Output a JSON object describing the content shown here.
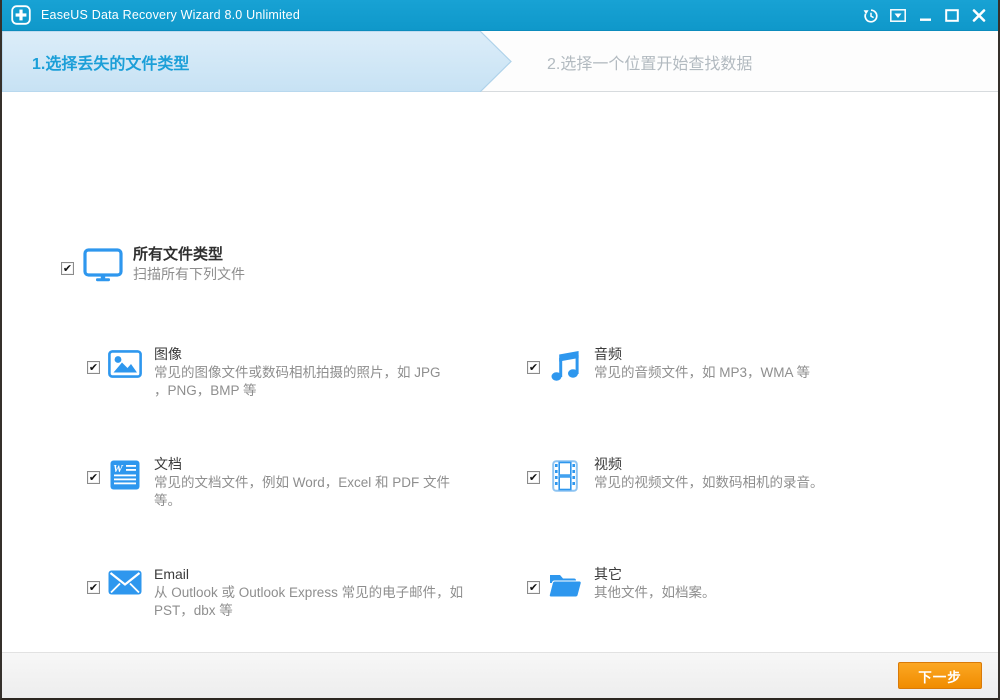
{
  "window": {
    "title": "EaseUS Data Recovery Wizard 8.0 Unlimited"
  },
  "titlebar_icons": [
    {
      "name": "history-icon"
    },
    {
      "name": "window-menu-icon"
    },
    {
      "name": "minimize-icon"
    },
    {
      "name": "maximize-icon"
    },
    {
      "name": "close-icon"
    }
  ],
  "steps": [
    {
      "label": "1.选择丢失的文件类型",
      "active": true
    },
    {
      "label": "2.选择一个位置开始查找数据",
      "active": false
    }
  ],
  "all_types": {
    "checked": true,
    "icon": "monitor-icon",
    "title": "所有文件类型",
    "desc": "扫描所有下列文件"
  },
  "file_types": [
    {
      "checked": true,
      "icon": "image-icon",
      "title": "图像",
      "desc": "常见的图像文件或数码相机拍摄的照片，如 JPG\n，PNG，BMP 等"
    },
    {
      "checked": true,
      "icon": "audio-icon",
      "title": "音频",
      "desc": "常见的音频文件，如 MP3，WMA 等"
    },
    {
      "checked": true,
      "icon": "document-icon",
      "title": "文档",
      "desc": "常见的文档文件，例如 Word，Excel 和 PDF 文件\n等。"
    },
    {
      "checked": true,
      "icon": "video-icon",
      "title": "视频",
      "desc": "常见的视频文件，如数码相机的录音。"
    },
    {
      "checked": true,
      "icon": "email-icon",
      "title": "Email",
      "desc": "从 Outlook 或 Outlook Express 常见的电子邮件，如\nPST，dbx 等"
    },
    {
      "checked": true,
      "icon": "folder-icon",
      "title": "其它",
      "desc": "其他文件，如档案。"
    }
  ],
  "footer": {
    "next_label": "下一步"
  },
  "colors": {
    "titlebar": "#129bcd",
    "accent_blue": "#2e97ee",
    "step_active_text": "#1b9fd8",
    "step_inactive_text": "#b2bac0",
    "step_band_fill": "#d3e8f7",
    "next_button": "#f6941e",
    "next_button_border": "#d97a08"
  }
}
